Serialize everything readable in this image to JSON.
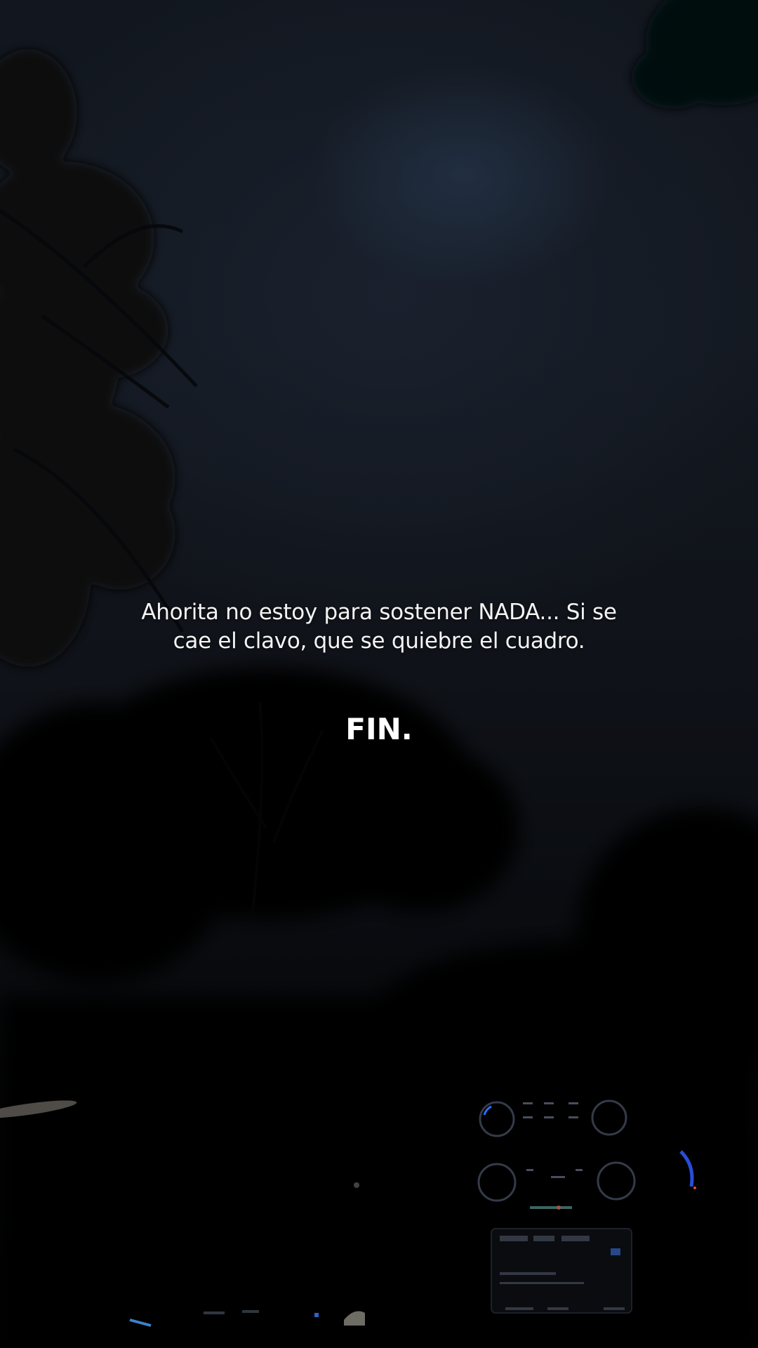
{
  "caption": {
    "text": "Ahorita no estoy para sostener NADA... Si se cae el clavo, que se quiebre el cuadro."
  },
  "ending": {
    "text": "FIN."
  },
  "scene": {
    "description_colors": {
      "sky_top": "#12171f",
      "sky_bottom": "#020203",
      "moon_glow": "#283c55",
      "dashboard_accent": "#2f6bff"
    }
  }
}
